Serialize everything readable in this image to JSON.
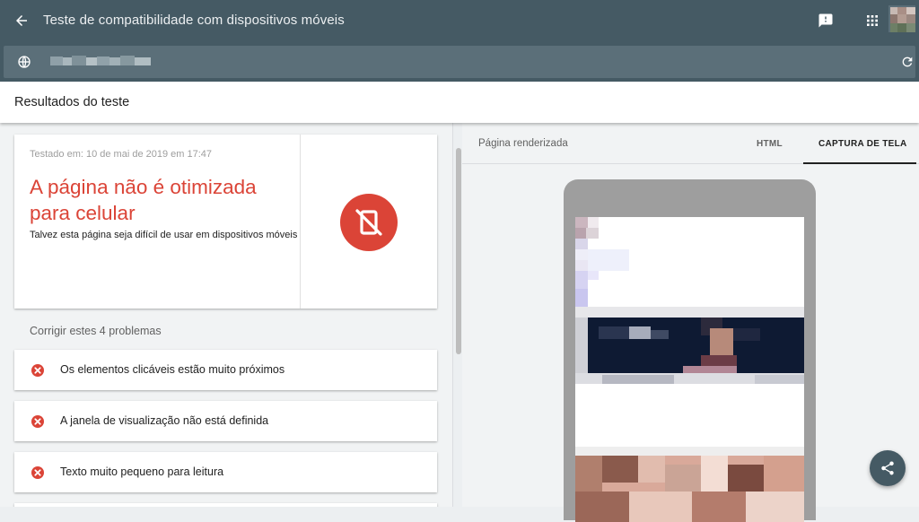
{
  "app": {
    "title": "Teste de compatibilidade com dispositivos móveis"
  },
  "icons": {
    "back": "arrow-back-icon",
    "feedback": "feedback-icon",
    "apps": "apps-grid-icon",
    "globe": "globe-icon",
    "reload": "reload-icon",
    "not_mobile_friendly": "mobile-off-icon",
    "error": "error-icon",
    "share": "share-icon"
  },
  "results": {
    "header": "Resultados do teste",
    "tested_at": "Testado em: 10 de mai de 2019 em 17:47",
    "headline": "A página não é otimizada para celular",
    "description": "Talvez esta página seja difícil de usar em dispositivos móveis",
    "fix_label": "Corrigir estes 4 problemas",
    "issues": [
      {
        "label": "Os elementos clicáveis estão muito próximos"
      },
      {
        "label": "A janela de visualização não está definida"
      },
      {
        "label": "Texto muito pequeno para leitura"
      }
    ]
  },
  "preview": {
    "rendered_label": "Página renderizada",
    "tabs": [
      {
        "label": "HTML",
        "selected": false
      },
      {
        "label": "CAPTURA DE TELA",
        "selected": true
      }
    ]
  },
  "colors": {
    "toolbar": "#455a64",
    "error_red": "#db4437",
    "background": "#f1f3f4"
  }
}
